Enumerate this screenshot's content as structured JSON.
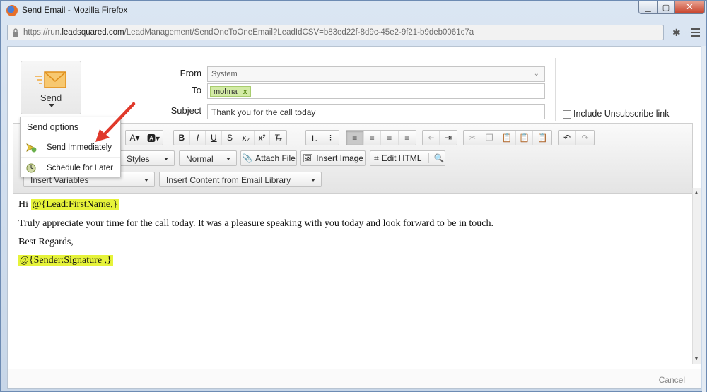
{
  "window": {
    "title": "Send Email - Mozilla Firefox",
    "url_prefix": "https://run.",
    "url_domain": "leadsquared.com",
    "url_path": "/LeadManagement/SendOneToOneEmail?LeadIdCSV=b83ed22f-8d9c-45e2-9f21-b9deb0061c7a"
  },
  "compose": {
    "send_label": "Send",
    "from_label": "From",
    "from_value": "System",
    "to_label": "To",
    "to_recipient": "mohna",
    "to_remove": "x",
    "subject_label": "Subject",
    "subject_value": "Thank you for the call today",
    "unsubscribe_label": "Include Unsubscribe link"
  },
  "toolbar": {
    "styles_label": "Styles",
    "format_label": "Normal",
    "attach_file": "Attach File",
    "insert_image": "Insert Image",
    "edit_html": "Edit HTML",
    "insert_variables": "Insert Variables",
    "insert_library": "Insert Content from Email Library"
  },
  "send_menu": {
    "title": "Send options",
    "send_immediately": "Send Immediately",
    "schedule_later": "Schedule for Later"
  },
  "body": {
    "greeting": "Hi",
    "first_name_token": "@{Lead:FirstName,}",
    "line1": "Truly appreciate your time for the call today. It was a pleasure speaking with you today and look forward to be in touch.",
    "closing": "Best Regards,",
    "signature_token": "@{Sender:Signature ,}"
  },
  "footer": {
    "cancel_label": "Cancel"
  },
  "colors": {
    "highlight": "#e6f33a",
    "chip_bg": "#d3eba6",
    "arrow": "#e0392b",
    "envelope": "#f2a93b"
  }
}
